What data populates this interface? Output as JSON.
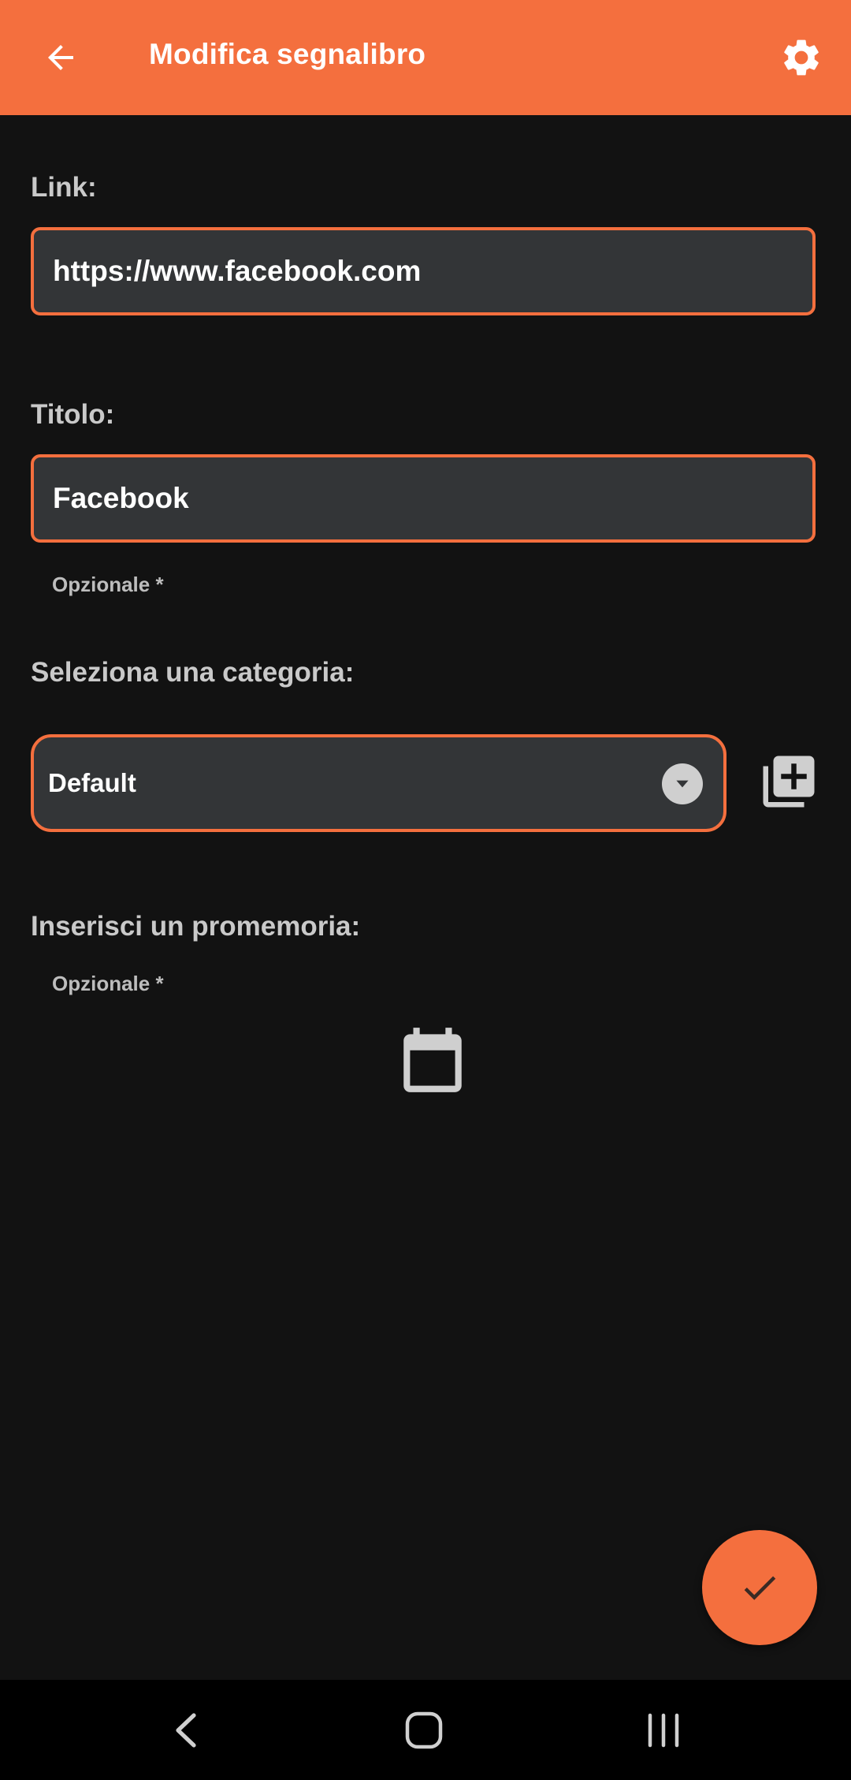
{
  "appbar": {
    "title": "Modifica segnalibro",
    "back_icon": "arrow-left-icon",
    "settings_icon": "gear-icon"
  },
  "link": {
    "label": "Link:",
    "value": "https://www.facebook.com"
  },
  "title_field": {
    "label": "Titolo:",
    "value": "Facebook",
    "hint": "Opzionale *"
  },
  "category": {
    "label": "Seleziona una categoria:",
    "selected": "Default",
    "dropdown_icon": "chevron-down-icon",
    "add_icon": "add-to-library-icon"
  },
  "reminder": {
    "label": "Inserisci un promemoria:",
    "hint": "Opzionale *",
    "calendar_icon": "calendar-icon"
  },
  "fab": {
    "icon": "checkmark-icon"
  },
  "navbar": {
    "back_icon": "nav-back-icon",
    "home_icon": "nav-home-icon",
    "recents_icon": "nav-recents-icon"
  },
  "colors": {
    "accent": "#F46F3E",
    "background": "#121212",
    "field_bg": "#333537"
  }
}
